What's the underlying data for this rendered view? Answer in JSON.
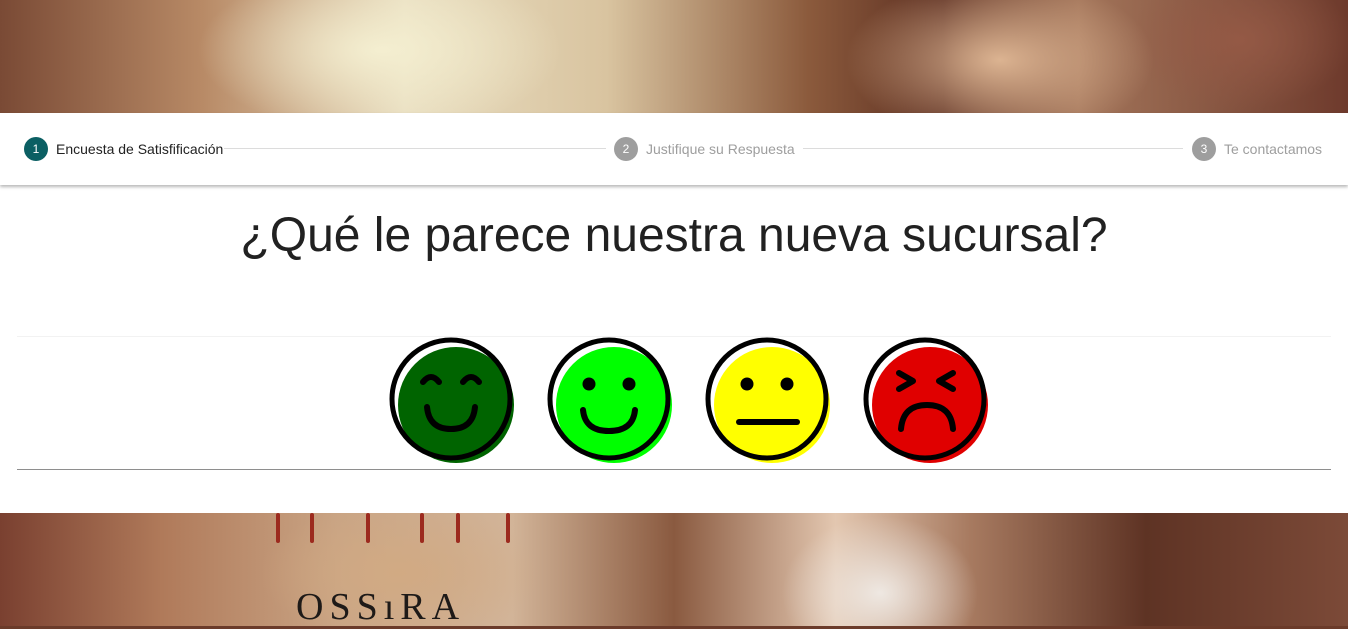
{
  "background": {
    "brand_text": "OSSıRA"
  },
  "stepper": {
    "steps": [
      {
        "number": "1",
        "label": "Encuesta de Satisfificación",
        "state": "active"
      },
      {
        "number": "2",
        "label": "Justifique su Respuesta",
        "state": "inactive"
      },
      {
        "number": "3",
        "label": "Te contactamos",
        "state": "inactive"
      }
    ]
  },
  "survey": {
    "question": "¿Qué le parece nuestra nueva sucursal?",
    "options": [
      {
        "icon": "very-happy-face-icon",
        "color": "#006400"
      },
      {
        "icon": "happy-face-icon",
        "color": "#00ff00"
      },
      {
        "icon": "neutral-face-icon",
        "color": "#ffff00"
      },
      {
        "icon": "angry-face-icon",
        "color": "#e00000"
      }
    ]
  },
  "colors": {
    "active_step": "#0b5f63",
    "inactive_step": "#9e9e9e"
  }
}
